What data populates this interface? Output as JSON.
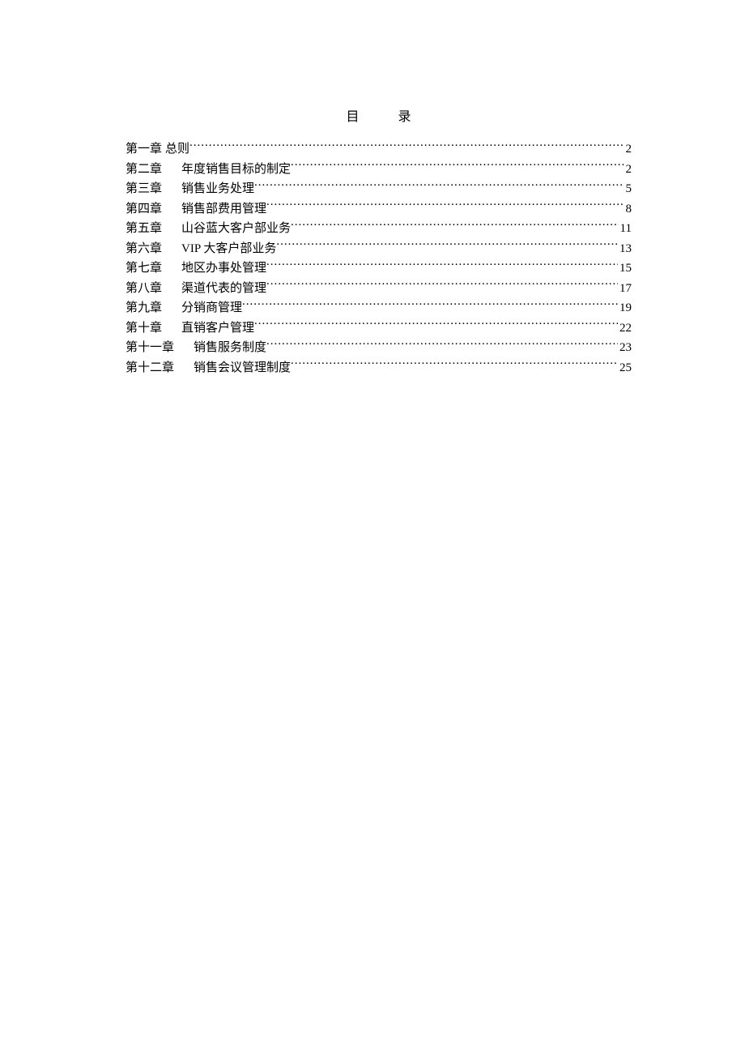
{
  "title": "目录",
  "entries": [
    {
      "label": "第一章",
      "gap": "small",
      "title": "总则",
      "page": "2"
    },
    {
      "label": "第二章",
      "gap": "wide",
      "title": "年度销售目标的制定",
      "page": "2"
    },
    {
      "label": "第三章",
      "gap": "wide",
      "title": "销售业务处理",
      "page": "5"
    },
    {
      "label": "第四章",
      "gap": "wide",
      "title": "销售部费用管理",
      "page": "8"
    },
    {
      "label": "第五章",
      "gap": "wide",
      "title": "山谷蓝大客户部业务",
      "page": "11"
    },
    {
      "label": "第六章",
      "gap": "wide",
      "title": "VIP 大客户部业务",
      "page": "13"
    },
    {
      "label": "第七章",
      "gap": "wide",
      "title": "地区办事处管理",
      "page": "15"
    },
    {
      "label": "第八章",
      "gap": "wide",
      "title": "渠道代表的管理",
      "page": "17"
    },
    {
      "label": "第九章",
      "gap": "wide",
      "title": "分销商管理",
      "page": "19"
    },
    {
      "label": "第十章",
      "gap": "wide",
      "title": "直销客户管理",
      "page": "22"
    },
    {
      "label": "第十一章",
      "gap": "wide",
      "title": "销售服务制度",
      "page": "23"
    },
    {
      "label": "第十二章",
      "gap": "wide",
      "title": "销售会议管理制度",
      "page": "25"
    }
  ]
}
